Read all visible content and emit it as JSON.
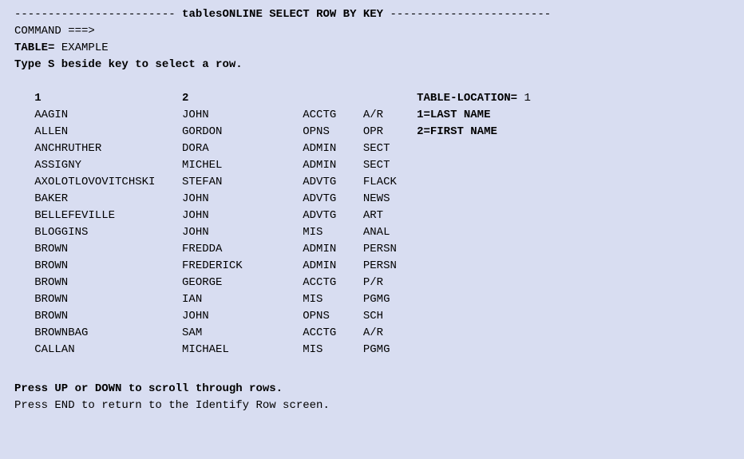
{
  "header": {
    "title_left_dashes": "------------------------ ",
    "title_text": "tablesONLINE SELECT ROW BY KEY",
    "title_right_dashes": " ------------------------",
    "command_label": "COMMAND ===>",
    "command_value": "",
    "table_label": "TABLE=",
    "table_value": " EXAMPLE",
    "type_instruction": "Type S beside key to select a row."
  },
  "columns": {
    "col1_header": "1",
    "col2_header": "2",
    "side": {
      "location_label": "TABLE-LOCATION=",
      "location_value": " 1",
      "key1": "1=LAST NAME",
      "key2": "2=FIRST NAME"
    }
  },
  "rows": [
    {
      "last": "AAGIN",
      "first": "JOHN",
      "dept": "ACCTG",
      "job": "A/R"
    },
    {
      "last": "ALLEN",
      "first": "GORDON",
      "dept": "OPNS",
      "job": "OPR"
    },
    {
      "last": "ANCHRUTHER",
      "first": "DORA",
      "dept": "ADMIN",
      "job": "SECT"
    },
    {
      "last": "ASSIGNY",
      "first": "MICHEL",
      "dept": "ADMIN",
      "job": "SECT"
    },
    {
      "last": "AXOLOTLOVOVITCHSKI",
      "first": "STEFAN",
      "dept": "ADVTG",
      "job": "FLACK"
    },
    {
      "last": "BAKER",
      "first": "JOHN",
      "dept": "ADVTG",
      "job": "NEWS"
    },
    {
      "last": "BELLEFEVILLE",
      "first": "JOHN",
      "dept": "ADVTG",
      "job": "ART"
    },
    {
      "last": "BLOGGINS",
      "first": "JOHN",
      "dept": "MIS",
      "job": "ANAL"
    },
    {
      "last": "BROWN",
      "first": "FREDDA",
      "dept": "ADMIN",
      "job": "PERSN"
    },
    {
      "last": "BROWN",
      "first": "FREDERICK",
      "dept": "ADMIN",
      "job": "PERSN"
    },
    {
      "last": "BROWN",
      "first": "GEORGE",
      "dept": "ACCTG",
      "job": "P/R"
    },
    {
      "last": "BROWN",
      "first": "IAN",
      "dept": "MIS",
      "job": "PGMG"
    },
    {
      "last": "BROWN",
      "first": "JOHN",
      "dept": "OPNS",
      "job": "SCH"
    },
    {
      "last": "BROWNBAG",
      "first": "SAM",
      "dept": "ACCTG",
      "job": "A/R"
    },
    {
      "last": "CALLAN",
      "first": "MICHAEL",
      "dept": "MIS",
      "job": "PGMG"
    }
  ],
  "footer": {
    "scroll_hint": "Press UP or DOWN to scroll through rows.",
    "return_hint": "Press END to return to the Identify Row screen."
  }
}
